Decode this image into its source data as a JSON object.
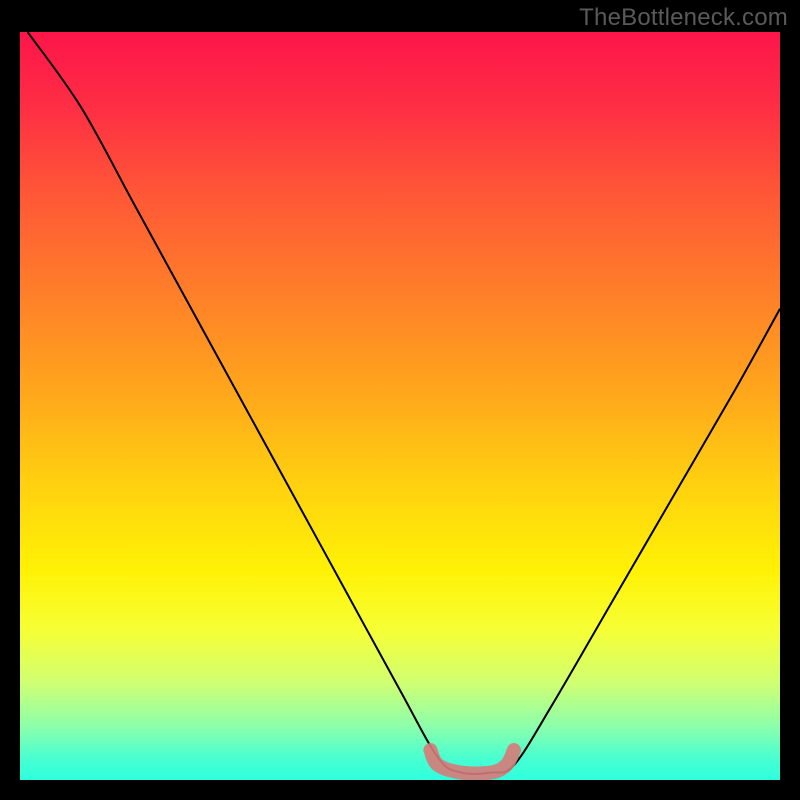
{
  "watermark": "TheBottleneck.com",
  "chart_data": {
    "type": "line",
    "title": "",
    "xlabel": "",
    "ylabel": "",
    "xlim": [
      0,
      100
    ],
    "ylim": [
      0,
      100
    ],
    "series": [
      {
        "name": "bottleneck-curve",
        "x": [
          1,
          8,
          15,
          22,
          29,
          36,
          43,
          50,
          55,
          58,
          62,
          65,
          70,
          78,
          86,
          94,
          100
        ],
        "y": [
          100,
          90,
          77,
          64,
          51,
          38,
          25,
          12,
          3,
          1,
          1,
          2,
          10,
          24,
          38,
          52,
          63
        ]
      }
    ],
    "highlight": {
      "name": "flat-bottom-marker",
      "x": [
        54,
        55,
        58,
        62,
        64,
        65
      ],
      "y": [
        4,
        2,
        1,
        1,
        2,
        4
      ]
    },
    "gradient_stops": [
      {
        "pos": 0,
        "color": "#fd154a"
      },
      {
        "pos": 10,
        "color": "#fe2e44"
      },
      {
        "pos": 22,
        "color": "#ff5836"
      },
      {
        "pos": 35,
        "color": "#ff7f29"
      },
      {
        "pos": 48,
        "color": "#ffa61c"
      },
      {
        "pos": 60,
        "color": "#ffcf10"
      },
      {
        "pos": 72,
        "color": "#fff205"
      },
      {
        "pos": 80,
        "color": "#f6ff36"
      },
      {
        "pos": 87,
        "color": "#d0ff72"
      },
      {
        "pos": 93,
        "color": "#8affad"
      },
      {
        "pos": 97,
        "color": "#49ffd0"
      },
      {
        "pos": 100,
        "color": "#2effdf"
      }
    ]
  }
}
